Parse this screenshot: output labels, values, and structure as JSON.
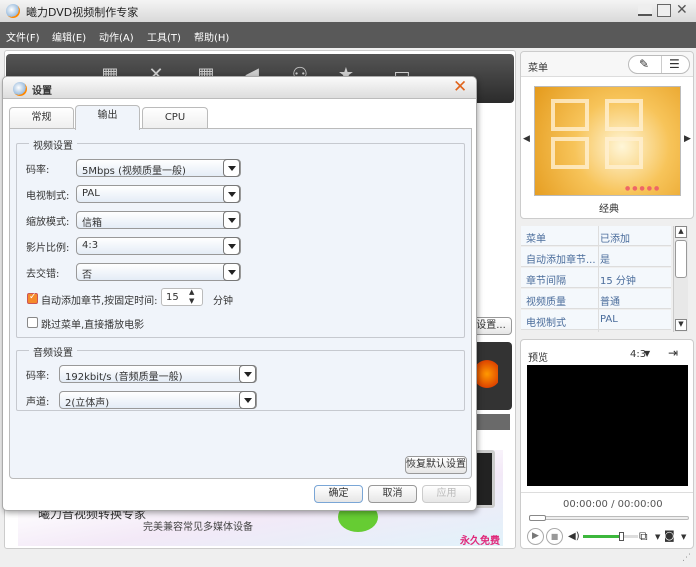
{
  "app": {
    "title": "曦力DVD视频制作专家"
  },
  "menu": [
    "文件(F)",
    "编辑(E)",
    "动作(A)",
    "工具(T)",
    "帮助(H)"
  ],
  "background": {
    "settings_button": "设置...",
    "ad_title": "曦力音视频转换专家",
    "ad_subtitle": "完美兼容常见多媒体设备",
    "ad_badge": "永久免费"
  },
  "dialog": {
    "title": "设置",
    "tabs": [
      {
        "label": "常规"
      },
      {
        "label": "输出",
        "active": true
      },
      {
        "label": "CPU"
      }
    ],
    "video": {
      "title": "视频设置",
      "fields": [
        {
          "label": "码率:",
          "value": "5Mbps (视频质量一般)"
        },
        {
          "label": "电视制式:",
          "value": "PAL"
        },
        {
          "label": "缩放模式:",
          "value": "信箱"
        },
        {
          "label": "影片比例:",
          "value": "4:3"
        },
        {
          "label": "去交错:",
          "value": "否"
        }
      ],
      "auto_chapter": {
        "label": "自动添加章节,按固定时间:",
        "checked": true,
        "value": "15",
        "unit": "分钟"
      },
      "skip_menu": {
        "label": "跳过菜单,直接播放电影",
        "checked": false
      }
    },
    "audio": {
      "title": "音频设置",
      "fields": [
        {
          "label": "码率:",
          "value": "192kbit/s (音频质量一般)"
        },
        {
          "label": "声道:",
          "value": "2(立体声)"
        }
      ]
    },
    "restore_label": "恢复默认设置",
    "ok_label": "确定",
    "cancel_label": "取消",
    "apply_label": "应用"
  },
  "menu_panel": {
    "title": "菜单",
    "template_name": "经典",
    "props": [
      [
        "菜单",
        "已添加"
      ],
      [
        "自动添加章节...",
        "是"
      ],
      [
        "章节间隔",
        "15 分钟"
      ],
      [
        "视频质量",
        "普通"
      ],
      [
        "电视制式",
        "PAL"
      ]
    ]
  },
  "preview": {
    "title": "预览",
    "aspect": "4:3",
    "time": "00:00:00 / 00:00:00",
    "volume": 0.7,
    "accent": "#3cb73c"
  }
}
